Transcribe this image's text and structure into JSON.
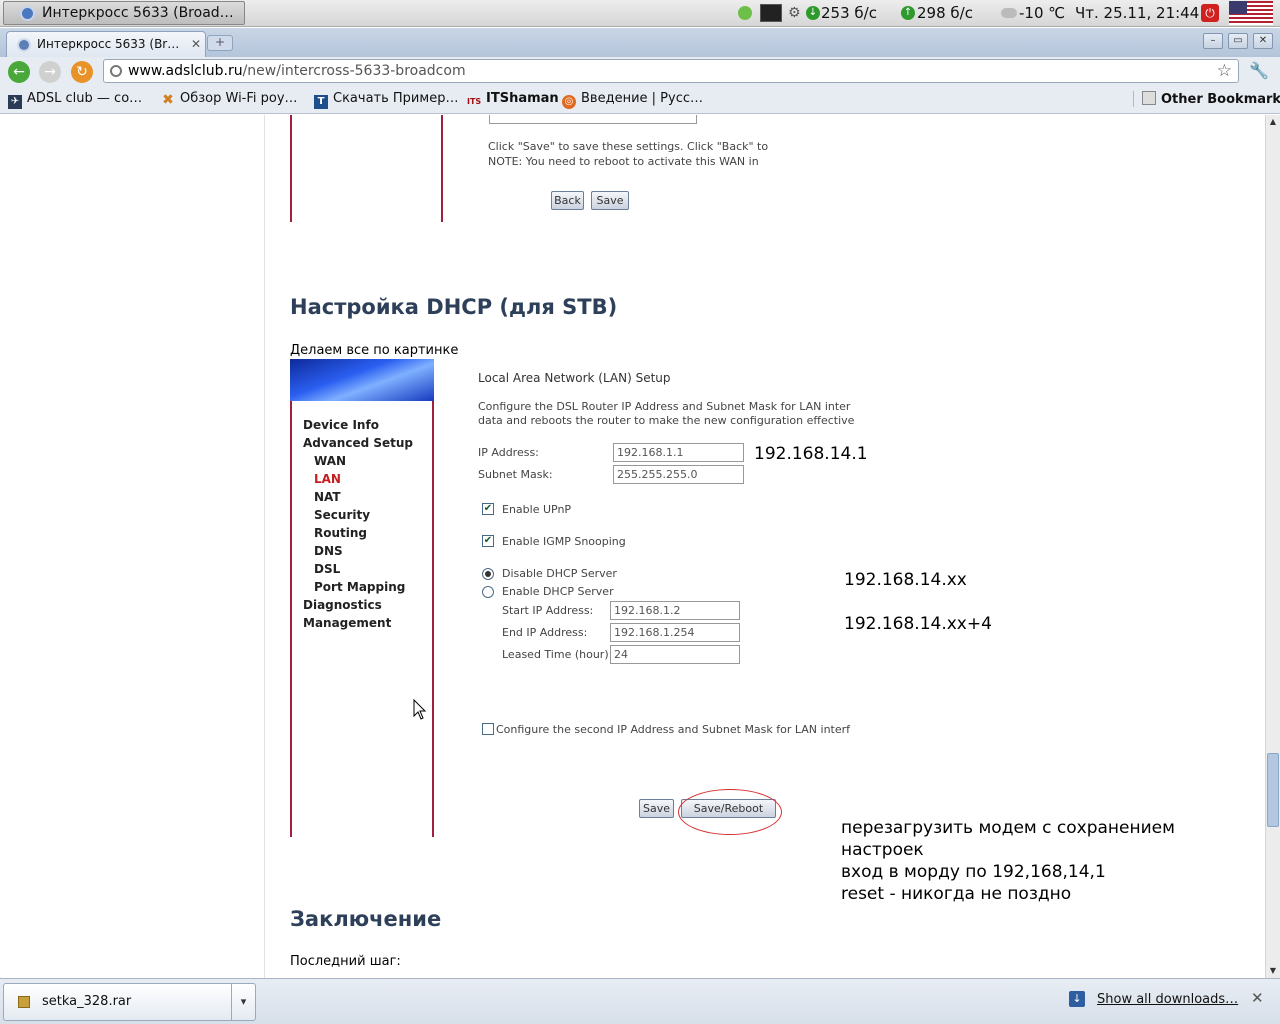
{
  "panel": {
    "window_button": "Интеркросс 5633 (Broad…",
    "net_down": "253 б/с",
    "net_up": "298 б/с",
    "temperature": "-10 ℃",
    "clock": "Чт. 25.11, 21:44"
  },
  "browser": {
    "tab_title": "Интеркросс 5633 (Br…",
    "url_host": "www.adslclub.ru",
    "url_path": "/new/intercross-5633-broadcom",
    "bookmarks": [
      {
        "label": "ADSL club — co…",
        "icon": "adsl-icon"
      },
      {
        "label": "Обзор Wi-Fi роу…",
        "icon": "x-icon"
      },
      {
        "label": "Скачать Пример…",
        "icon": "t-icon"
      },
      {
        "label": "ITShaman",
        "icon": "its-icon"
      },
      {
        "label": "Введение | Русс…",
        "icon": "ubuntu-icon"
      }
    ],
    "other_bookmarks": "Other Bookmarks"
  },
  "page": {
    "top_shot": {
      "text1": "Click \"Save\" to save these settings. Click \"Back\" to",
      "text2": "NOTE: You need to reboot to activate this WAN in",
      "back": "Back",
      "save": "Save"
    },
    "heading1": "Настройка DHCP (для STB)",
    "intro": "Делаем все по картинке",
    "router": {
      "menu": [
        {
          "label": "Device Info",
          "sub": false,
          "active": false
        },
        {
          "label": "Advanced Setup",
          "sub": false,
          "active": false
        },
        {
          "label": "WAN",
          "sub": true,
          "active": false
        },
        {
          "label": "LAN",
          "sub": true,
          "active": true
        },
        {
          "label": "NAT",
          "sub": true,
          "active": false
        },
        {
          "label": "Security",
          "sub": true,
          "active": false
        },
        {
          "label": "Routing",
          "sub": true,
          "active": false
        },
        {
          "label": "DNS",
          "sub": true,
          "active": false
        },
        {
          "label": "DSL",
          "sub": true,
          "active": false
        },
        {
          "label": "Port Mapping",
          "sub": true,
          "active": false
        },
        {
          "label": "Diagnostics",
          "sub": false,
          "active": false
        },
        {
          "label": "Management",
          "sub": false,
          "active": false
        }
      ],
      "title": "Local Area Network (LAN) Setup",
      "desc1": "Configure the DSL Router IP Address and Subnet Mask for LAN inter",
      "desc2": "data and reboots the router to make the new configuration effective",
      "ip_label": "IP Address:",
      "ip_value": "192.168.1.1",
      "mask_label": "Subnet Mask:",
      "mask_value": "255.255.255.0",
      "upnp": "Enable UPnP",
      "igmp": "Enable IGMP Snooping",
      "disable_dhcp": "Disable DHCP Server",
      "enable_dhcp": "Enable DHCP Server",
      "start_label": "Start IP Address:",
      "start_value": "192.168.1.2",
      "end_label": "End IP Address:",
      "end_value": "192.168.1.254",
      "lease_label": "Leased Time (hour):",
      "lease_value": "24",
      "second_ip": "Configure the second IP Address and Subnet Mask for LAN interf",
      "save": "Save",
      "save_reboot": "Save/Reboot"
    },
    "annotations": {
      "ip": "192.168.14.1",
      "start": "192.168.14.xx",
      "end": "192.168.14.xx+4",
      "note1": "перезагрузить модем с сохранением",
      "note2": "настроек",
      "note3": "вход в морду по 192,168,14,1",
      "note4": "reset - никогда не поздно"
    },
    "heading2": "Заключение",
    "last_step": "Последний шаг:"
  },
  "downloads": {
    "file": "setka_328.rar",
    "show_all": "Show all downloads…"
  },
  "colors": {
    "heading": "#2d3f59",
    "frame": "#a02040",
    "active_menu": "#c41e1e",
    "annotation_oval": "#d63030"
  }
}
